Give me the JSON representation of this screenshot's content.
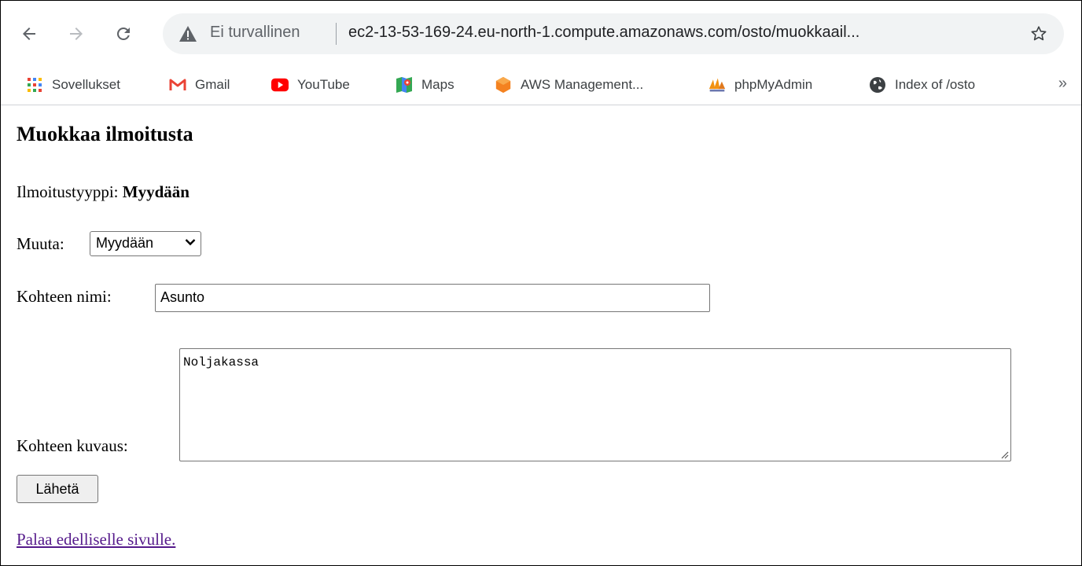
{
  "browser": {
    "security_label": "Ei turvallinen",
    "url": "ec2-13-53-169-24.eu-north-1.compute.amazonaws.com/osto/muokkaail...",
    "bookmarks": [
      {
        "label": "Sovellukset",
        "icon": "apps-grid-icon"
      },
      {
        "label": "Gmail",
        "icon": "gmail-icon"
      },
      {
        "label": "YouTube",
        "icon": "youtube-icon"
      },
      {
        "label": "Maps",
        "icon": "maps-icon"
      },
      {
        "label": "AWS Management...",
        "icon": "aws-icon"
      },
      {
        "label": "phpMyAdmin",
        "icon": "phpmyadmin-icon"
      },
      {
        "label": "Index of /osto",
        "icon": "globe-icon"
      }
    ],
    "more_label": "»"
  },
  "page": {
    "title": "Muokkaa ilmoitusta",
    "type_label": "Ilmoitustyyppi:",
    "type_value": "Myydään",
    "change_label": "Muuta:",
    "change_selected": "Myydään",
    "name_label": "Kohteen nimi:",
    "name_value": "Asunto",
    "description_label": "Kohteen kuvaus:",
    "description_value": "Noljakassa",
    "submit_label": "Lähetä",
    "back_link": "Palaa edelliselle sivulle."
  },
  "colors": {
    "link_visited": "#551a8b",
    "warning_icon": "#5f6368",
    "omnibox_bg": "#f1f3f4"
  }
}
